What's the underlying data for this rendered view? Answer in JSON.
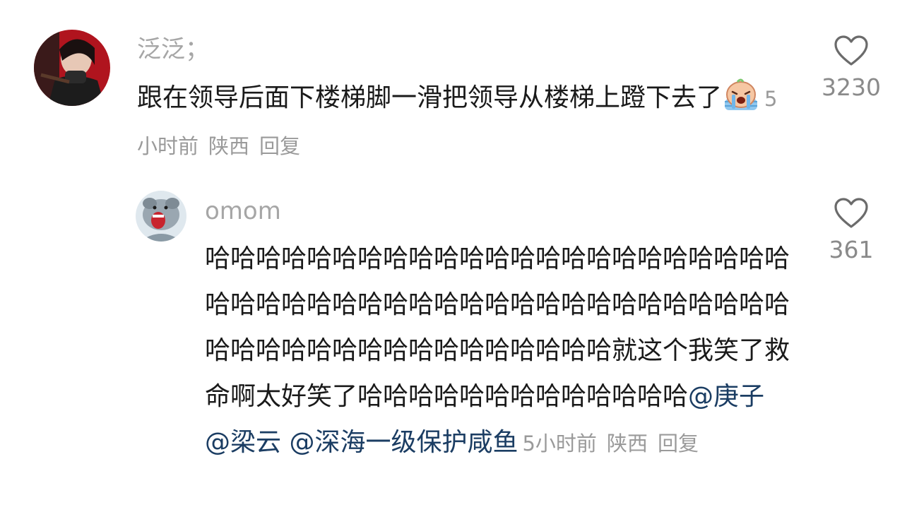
{
  "comment": {
    "username": "泛泛；",
    "text_before_emoji": "跟在领导后面下楼梯脚一滑把领导从楼梯上蹬下去了",
    "emoji": "crying-face-emoji",
    "time": "5小时前",
    "location": "陕西",
    "reply_label": "回复",
    "likes": "3230"
  },
  "reply": {
    "username": "omom",
    "text": "哈哈哈哈哈哈哈哈哈哈哈哈哈哈哈哈哈哈哈哈哈哈哈哈哈哈哈哈哈哈哈哈哈哈哈哈哈哈哈哈哈哈哈哈哈哈哈哈哈哈哈哈哈哈哈哈哈哈哈哈哈哈就这个我笑了救命啊太好笑了哈哈哈哈哈哈哈哈哈哈哈哈哈",
    "mentions": [
      "@庚子",
      "@梁云",
      "@深海一级保护咸鱼"
    ],
    "time": "5小时前",
    "location": "陕西",
    "reply_label": "回复",
    "likes": "361"
  },
  "colors": {
    "username": "#a6a6a6",
    "text": "#1a1a1a",
    "mention": "#1b3d63",
    "meta": "#9a9a9a",
    "like_icon": "#6b6b6b"
  },
  "icons": [
    "heart-outline-icon"
  ]
}
